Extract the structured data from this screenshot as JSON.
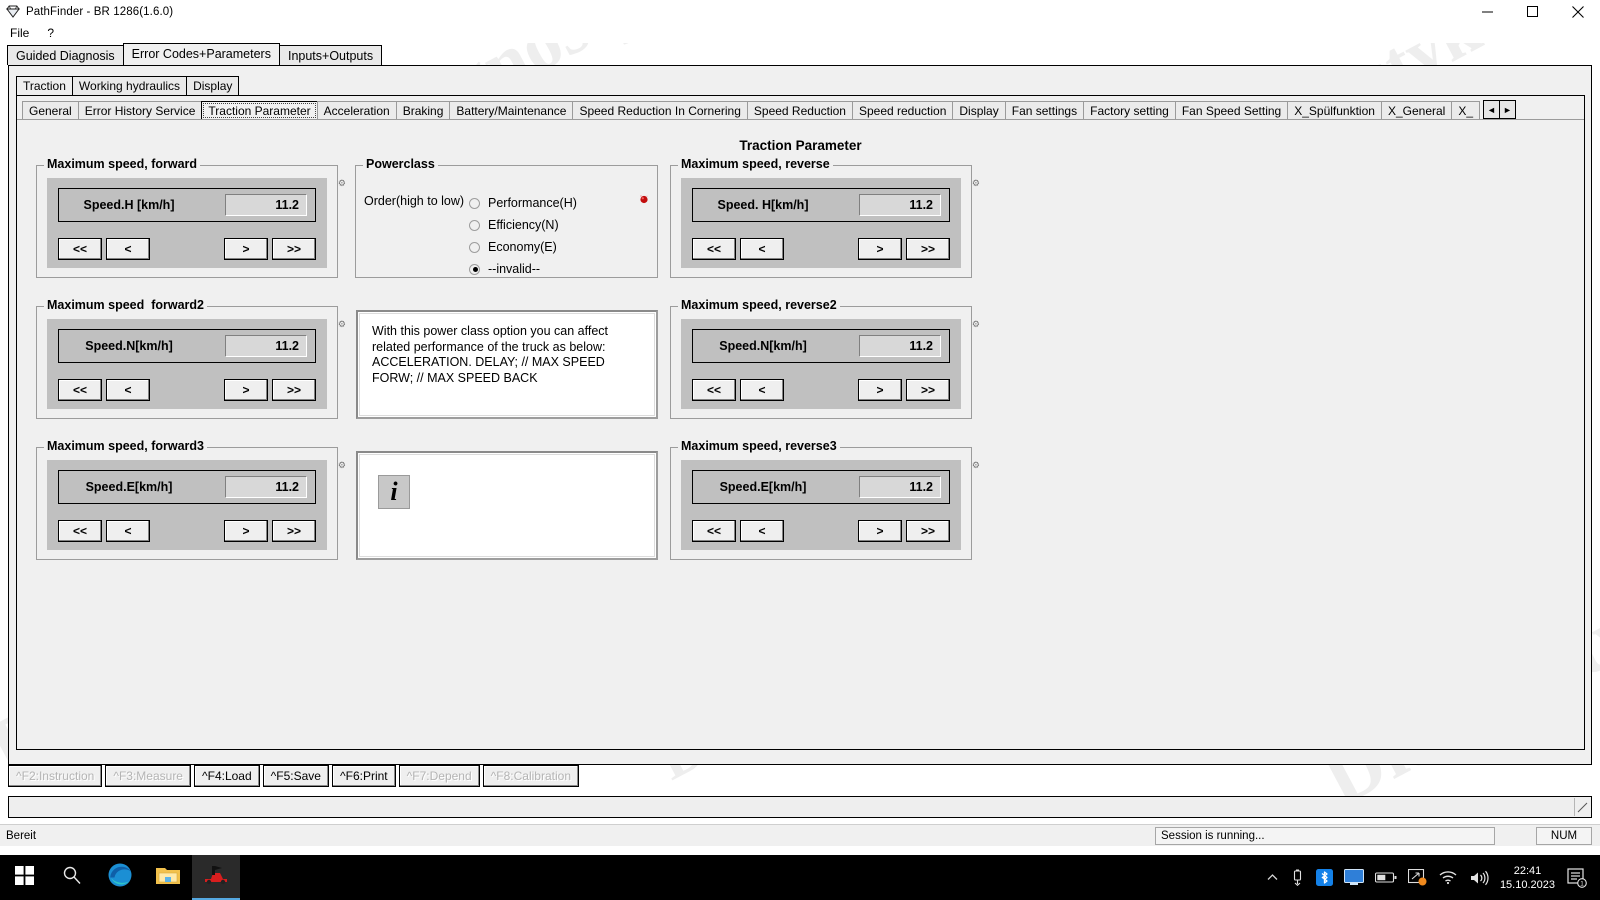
{
  "window": {
    "title": "PathFinder - BR 1286(1.6.0)",
    "icon": "diamond-icon",
    "minimize": "—",
    "maximize": "❐",
    "close": "✕"
  },
  "menubar": {
    "items": [
      "File",
      "?"
    ]
  },
  "tabs_level1": [
    {
      "label": "Guided Diagnosis",
      "selected": false
    },
    {
      "label": "Error Codes+Parameters",
      "selected": true
    },
    {
      "label": "Inputs+Outputs",
      "selected": false
    }
  ],
  "tabs_level2": [
    {
      "label": "Traction",
      "selected": true
    },
    {
      "label": "Working hydraulics",
      "selected": false
    },
    {
      "label": "Display",
      "selected": false
    }
  ],
  "tabs_level3": [
    {
      "label": "General",
      "selected": false
    },
    {
      "label": "Error History Service",
      "selected": false
    },
    {
      "label": "Traction Parameter",
      "selected": true
    },
    {
      "label": "Acceleration",
      "selected": false
    },
    {
      "label": "Braking",
      "selected": false
    },
    {
      "label": "Battery/Maintenance",
      "selected": false
    },
    {
      "label": "Speed Reduction In Cornering",
      "selected": false
    },
    {
      "label": "Speed Reduction",
      "selected": false
    },
    {
      "label": "Speed reduction",
      "selected": false
    },
    {
      "label": "Display",
      "selected": false
    },
    {
      "label": "Fan settings",
      "selected": false
    },
    {
      "label": "Factory setting",
      "selected": false
    },
    {
      "label": "Fan Speed Setting",
      "selected": false
    },
    {
      "label": "X_Spülfunktion",
      "selected": false
    },
    {
      "label": "X_General",
      "selected": false
    },
    {
      "label": "X_",
      "selected": false
    }
  ],
  "tab_scroll": {
    "left": "◄",
    "right": "►"
  },
  "page_title": "Traction Parameter",
  "nav_buttons": {
    "first": "<<",
    "prev": "<",
    "next": ">",
    "last": ">>"
  },
  "speed_groups": [
    {
      "id": "max-speed-forward",
      "title": "Maximum speed, forward",
      "label": "Speed.H [km/h]",
      "value": "11.2"
    },
    {
      "id": "max-speed-forward2",
      "title": "Maximum speed  forward2",
      "label": "Speed.N[km/h]",
      "value": "11.2"
    },
    {
      "id": "max-speed-forward3",
      "title": "Maximum speed, forward3",
      "label": "Speed.E[km/h]",
      "value": "11.2"
    },
    {
      "id": "max-speed-reverse",
      "title": "Maximum speed, reverse",
      "label": "Speed. H[km/h]",
      "value": "11.2"
    },
    {
      "id": "max-speed-reverse2",
      "title": "Maximum speed, reverse2",
      "label": "Speed.N[km/h]",
      "value": "11.2"
    },
    {
      "id": "max-speed-reverse3",
      "title": "Maximum speed, reverse3",
      "label": "Speed.E[km/h]",
      "value": "11.2"
    }
  ],
  "powerclass": {
    "title": "Powerclass",
    "order_label": "Order(high to low)",
    "marker_color": "#cc0000",
    "options": [
      {
        "label": "Performance(H)",
        "checked": false
      },
      {
        "label": "Efficiency(N)",
        "checked": false
      },
      {
        "label": "Economy(E)",
        "checked": false
      },
      {
        "label": "--invalid--",
        "checked": true
      }
    ]
  },
  "description_box": {
    "text": "With this power class option you can affect related performance of the truck as below: ACCELERATION. DELAY; // MAX SPEED FORW; // MAX SPEED BACK"
  },
  "info_box": {
    "icon_glyph": "i",
    "icon_name": "information-icon"
  },
  "function_keys": [
    {
      "label": "^F2:Instruction",
      "enabled": false
    },
    {
      "label": "^F3:Measure",
      "enabled": false
    },
    {
      "label": "^F4:Load",
      "enabled": true
    },
    {
      "label": "^F5:Save",
      "enabled": true
    },
    {
      "label": "^F6:Print",
      "enabled": true
    },
    {
      "label": "^F7:Depend",
      "enabled": false
    },
    {
      "label": "^F8:Calibration",
      "enabled": false
    }
  ],
  "message_line": {
    "value": "",
    "grip": "◥"
  },
  "statusbar": {
    "left": "Bereit",
    "session": "Session is running...",
    "num": "NUM"
  },
  "taskbar": {
    "items": [
      {
        "name": "start-button",
        "icon": "windows-logo-icon"
      },
      {
        "name": "search-button",
        "icon": "search-icon"
      },
      {
        "name": "edge-button",
        "icon": "edge-browser-icon"
      },
      {
        "name": "explorer-button",
        "icon": "file-explorer-icon"
      },
      {
        "name": "pathfinder-button",
        "icon": "pathfinder-app-icon"
      }
    ],
    "tray": [
      {
        "name": "show-hidden-icons",
        "icon": "chevron-up-icon"
      },
      {
        "name": "usb-device",
        "icon": "usb-icon"
      },
      {
        "name": "bluetooth",
        "icon": "bluetooth-icon"
      },
      {
        "name": "display-settings",
        "icon": "monitor-icon"
      },
      {
        "name": "battery",
        "icon": "battery-icon"
      },
      {
        "name": "onedrive",
        "icon": "onedrive-sync-icon"
      },
      {
        "name": "network",
        "icon": "wifi-icon"
      },
      {
        "name": "volume",
        "icon": "speaker-icon"
      }
    ],
    "clock_time": "22:41",
    "clock_date": "15.10.2023",
    "notifications": {
      "icon": "notification-icon",
      "count": "1"
    }
  },
  "watermark": {
    "text": "Diagnostyka24"
  }
}
